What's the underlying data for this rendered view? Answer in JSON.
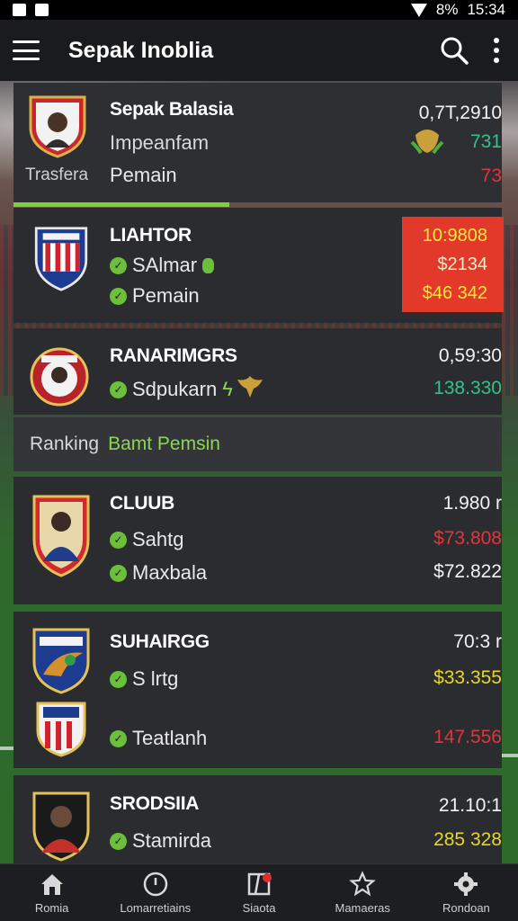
{
  "status": {
    "battery": "8%",
    "time": "15:34"
  },
  "appbar": {
    "title": "Sepak Inoblia"
  },
  "featured": {
    "name": "Sepak Balasia",
    "subtitle": "Impeanfam",
    "left_label": "Trasfera",
    "label": "Pemain",
    "value_top": "0,7T,2910",
    "value_mid": "731",
    "value_bottom": "73"
  },
  "rows": [
    {
      "name": "LIAHTOR",
      "line1": "SAlmar",
      "line2": "Pemain",
      "value1": "10:9808",
      "value2": "$2134",
      "value3": "$46 342"
    },
    {
      "name": "RANARIMGRS",
      "line1": "Sdpukarn",
      "value1": "0,59:30",
      "value2": "138.330"
    },
    {
      "name": "CLUUB",
      "line1": "Sahtg",
      "line2": "Maxbala",
      "value1": "1.980 r",
      "value2": "$73.808",
      "value3": "$72.822"
    },
    {
      "name": "SUHAIRGG",
      "line1": "S lrtg",
      "line2": "Teatlanh",
      "value1": "70:3 r",
      "value2": "$33.355",
      "value3": "147.556"
    },
    {
      "name": "SRODSIIA",
      "line1": "Stamirda",
      "value1": "21.10:1",
      "value2": "285 328"
    }
  ],
  "ranking": {
    "tab1": "Ranking",
    "tab2": "Bamt Pemsin"
  },
  "nav": [
    {
      "label": "Romia",
      "icon": "home-icon"
    },
    {
      "label": "Lomarretiains",
      "icon": "clock-icon"
    },
    {
      "label": "Siaota",
      "icon": "board-icon"
    },
    {
      "label": "Mamaeras",
      "icon": "star-icon"
    },
    {
      "label": "Rondoan",
      "icon": "gear-icon"
    }
  ],
  "colors": {
    "accent_green": "#7fd13a",
    "highlight_red": "#e2392b",
    "value_yellow": "#e7d62a",
    "value_red": "#e2353b",
    "value_green": "#33c18a"
  }
}
